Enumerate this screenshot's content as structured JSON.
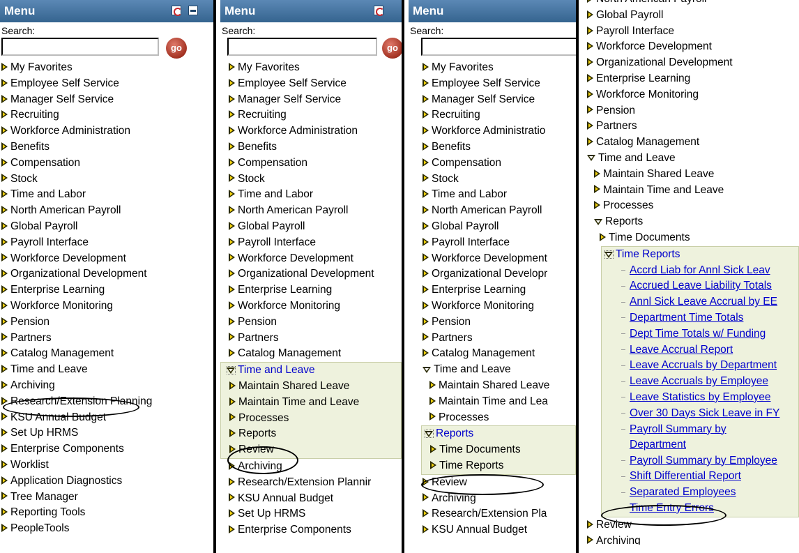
{
  "menu_title": "Menu",
  "search_label": "Search:",
  "search_placeholder": "",
  "go_label": "go",
  "panel1_items": [
    "My Favorites",
    "Employee Self Service",
    "Manager Self Service",
    "Recruiting",
    "Workforce Administration",
    "Benefits",
    "Compensation",
    "Stock",
    "Time and Labor",
    "North American Payroll",
    "Global Payroll",
    "Payroll Interface",
    "Workforce Development",
    "Organizational Development",
    "Enterprise Learning",
    "Workforce Monitoring",
    "Pension",
    "Partners",
    "Catalog Management",
    "Time and Leave",
    "Archiving",
    "Research/Extension Planning",
    "KSU Annual Budget",
    "Set Up HRMS",
    "Enterprise Components",
    "Worklist",
    "Application Diagnostics",
    "Tree Manager",
    "Reporting Tools",
    "PeopleTools"
  ],
  "panel2": {
    "top_items": [
      "My Favorites",
      "Employee Self Service",
      "Manager Self Service",
      "Recruiting",
      "Workforce Administration",
      "Benefits",
      "Compensation",
      "Stock",
      "Time and Labor",
      "North American Payroll",
      "Global Payroll",
      "Payroll Interface",
      "Workforce Development",
      "Organizational Development",
      "Enterprise Learning",
      "Workforce Monitoring",
      "Pension",
      "Partners",
      "Catalog Management"
    ],
    "expanded": "Time and Leave",
    "sub_items": [
      "Maintain Shared Leave",
      "Maintain Time and Leave",
      "Processes",
      "Reports",
      "Review"
    ],
    "bottom_items": [
      "Archiving",
      "Research/Extension Plannir",
      "KSU Annual Budget",
      "Set Up HRMS",
      "Enterprise Components"
    ]
  },
  "panel3": {
    "top_items": [
      "My Favorites",
      "Employee Self Service",
      "Manager Self Service",
      "Recruiting",
      "Workforce Administratio",
      "Benefits",
      "Compensation",
      "Stock",
      "Time and Labor",
      "North American Payroll",
      "Global Payroll",
      "Payroll Interface",
      "Workforce Development",
      "Organizational Developr",
      "Enterprise Learning",
      "Workforce Monitoring",
      "Pension",
      "Partners",
      "Catalog Management"
    ],
    "expanded": "Time and Leave",
    "sub_items": [
      "Maintain Shared Leave",
      "Maintain Time and Lea",
      "Processes"
    ],
    "reports_label": "Reports",
    "reports_children": [
      "Time Documents",
      "Time Reports"
    ],
    "after_items": [
      "Review"
    ],
    "bottom_items": [
      "Archiving",
      "Research/Extension Pla",
      "KSU Annual Budget"
    ]
  },
  "panel4": {
    "top_partial": "North American Payroll",
    "top_items": [
      "Global Payroll",
      "Payroll Interface",
      "Workforce Development",
      "Organizational Development",
      "Enterprise Learning",
      "Workforce Monitoring",
      "Pension",
      "Partners",
      "Catalog Management"
    ],
    "expanded": "Time and Leave",
    "sub_items": [
      "Maintain Shared Leave",
      "Maintain Time and Leave",
      "Processes"
    ],
    "reports_label": "Reports",
    "time_documents": "Time Documents",
    "time_reports_label": "Time Reports",
    "report_links": [
      "Accrd Liab for Annl Sick Leav",
      "Accrued Leave Liability Totals",
      "Annl Sick Leave Accrual by EE",
      "Department Time Totals",
      "Dept Time Totals w/ Funding",
      "Leave Accrual Report",
      "Leave Accruals by Department",
      "Leave Accruals by Employee",
      "Leave Statistics by Employee",
      "Over 30 Days Sick Leave in FY"
    ],
    "payroll_summary_by_dept": [
      "Payroll Summary by",
      "Department"
    ],
    "report_links2": [
      "Payroll Summary by Employee",
      "Shift Differential Report",
      "Separated Employees",
      "Time Entry Errors"
    ],
    "after_items": [
      "Review",
      "Archiving"
    ]
  }
}
